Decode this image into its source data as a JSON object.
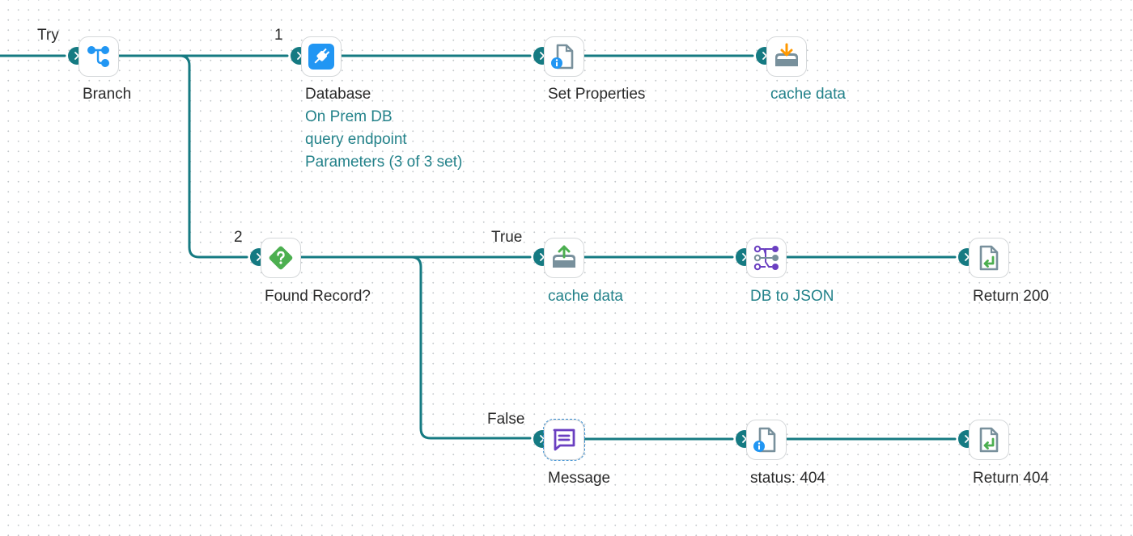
{
  "colors": {
    "connector": "#157a82",
    "port": "#157a82",
    "label": "#2a2a2a",
    "sublabel": "#23828a",
    "blue_icon": "#2196f3",
    "green_icon": "#4caf50",
    "purple_icon": "#6a3fc1",
    "orange_icon": "#ff9800",
    "gray_icon": "#78909c"
  },
  "edge_labels": {
    "try": "Try",
    "step1": "1",
    "step2": "2",
    "true": "True",
    "false": "False"
  },
  "nodes": {
    "branch": {
      "icon": "branch-icon",
      "title": "Branch"
    },
    "database": {
      "icon": "database-connector-icon",
      "title": "Database",
      "details": [
        "On Prem DB",
        "query endpoint",
        "Parameters (3 of 3 set)"
      ]
    },
    "set_properties": {
      "icon": "set-properties-icon",
      "title": "Set Properties"
    },
    "cache_store": {
      "icon": "cache-store-icon",
      "title": "cache data"
    },
    "found_record": {
      "icon": "decision-icon",
      "title": "Found Record?"
    },
    "cache_retrieve": {
      "icon": "cache-retrieve-icon",
      "title": "cache data"
    },
    "db_to_json": {
      "icon": "map-icon",
      "title": "DB to JSON"
    },
    "return_200": {
      "icon": "return-document-icon",
      "title": "Return 200"
    },
    "message": {
      "icon": "message-icon",
      "title": "Message",
      "selected": true
    },
    "status_404": {
      "icon": "set-properties-icon",
      "title": "status: 404"
    },
    "return_404": {
      "icon": "return-document-icon",
      "title": "Return 404"
    }
  }
}
